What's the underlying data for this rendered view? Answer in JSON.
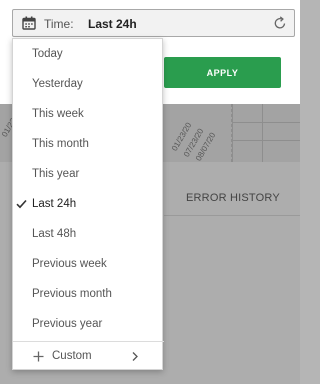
{
  "time_picker": {
    "label": "Time:",
    "value": "Last 24h"
  },
  "apply_button": {
    "label": "APPLY"
  },
  "background": {
    "tab_label": "ERROR HISTORY",
    "date_fragments": [
      "01/23/20",
      "07/23/20",
      "08/07/20"
    ]
  },
  "menu": {
    "selected": "Last 24h",
    "items": [
      "Today",
      "Yesterday",
      "This week",
      "This month",
      "This year",
      "Last 24h",
      "Last 48h",
      "Previous week",
      "Previous month",
      "Previous year"
    ],
    "custom_label": "Custom"
  },
  "colors": {
    "apply_green": "#2a9d4e",
    "overlay_gray": "#b5b5b5"
  }
}
